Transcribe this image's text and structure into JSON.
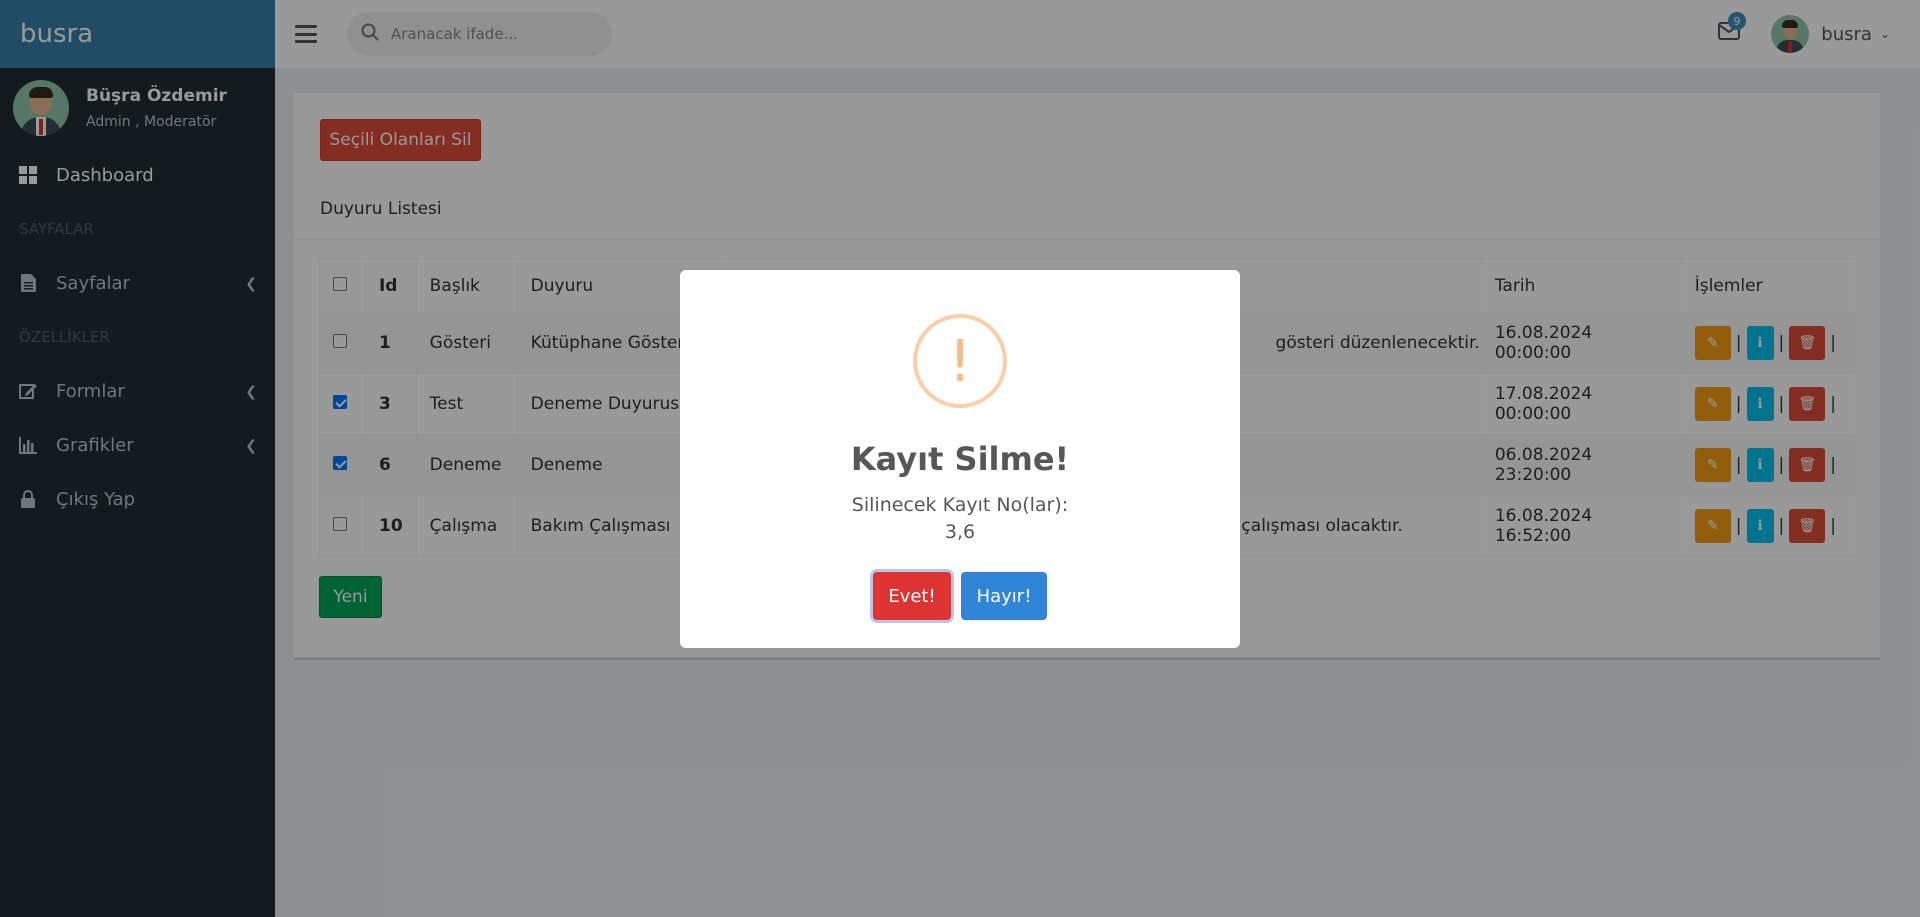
{
  "brand": "busra",
  "user": {
    "name": "Büşra Özdemir",
    "role": "Admin , Moderatör"
  },
  "sidebar": {
    "items": [
      {
        "label": "Dashboard"
      },
      {
        "header": "SAYFALAR"
      },
      {
        "label": "Sayfalar"
      },
      {
        "header": "ÖZELLİKLER"
      },
      {
        "label": "Formlar"
      },
      {
        "label": "Grafikler"
      },
      {
        "label": "Çıkış Yap"
      }
    ]
  },
  "header": {
    "search_placeholder": "Aranacak ifade...",
    "mail_count": "9",
    "username": "busra"
  },
  "main": {
    "delete_selected_label": "Seçili Olanları Sil",
    "list_title": "Duyuru Listesi",
    "columns": [
      "Id",
      "Başlık",
      "Duyuru",
      "",
      "Tarih",
      "İşlemler"
    ],
    "rows": [
      {
        "id": "1",
        "title": "Gösteri",
        "announcement": "Kütüphane Göster",
        "detail": "gösteri düzenlenecektir.",
        "date": "16.08.2024 00:00:00",
        "checked": false
      },
      {
        "id": "3",
        "title": "Test",
        "announcement": "Deneme Duyurusu",
        "detail": "",
        "date": "17.08.2024 00:00:00",
        "checked": true
      },
      {
        "id": "6",
        "title": "Deneme",
        "announcement": "Deneme",
        "detail": "",
        "date": "06.08.2024 23:20:00",
        "checked": true
      },
      {
        "id": "10",
        "title": "Çalışma",
        "announcement": "Bakım Çalışması",
        "detail": "m çalışması olacaktır.",
        "date": "16.08.2024 16:52:00",
        "checked": false
      }
    ],
    "new_label": "Yeni"
  },
  "modal": {
    "icon_symbol": "!",
    "title": "Kayıt Silme!",
    "text_line1": "Silinecek Kayıt No(lar):",
    "text_line2": "3,6",
    "confirm_label": "Evet!",
    "cancel_label": "Hayır!"
  },
  "colors": {
    "sidebar_bg": "#222d32",
    "brand_bg": "#367fa9",
    "danger": "#dd4b39",
    "success": "#00a65a",
    "warning": "#f39c12",
    "info": "#00c0ef",
    "modal_confirm": "#dd3333",
    "modal_cancel": "#3085d6"
  }
}
